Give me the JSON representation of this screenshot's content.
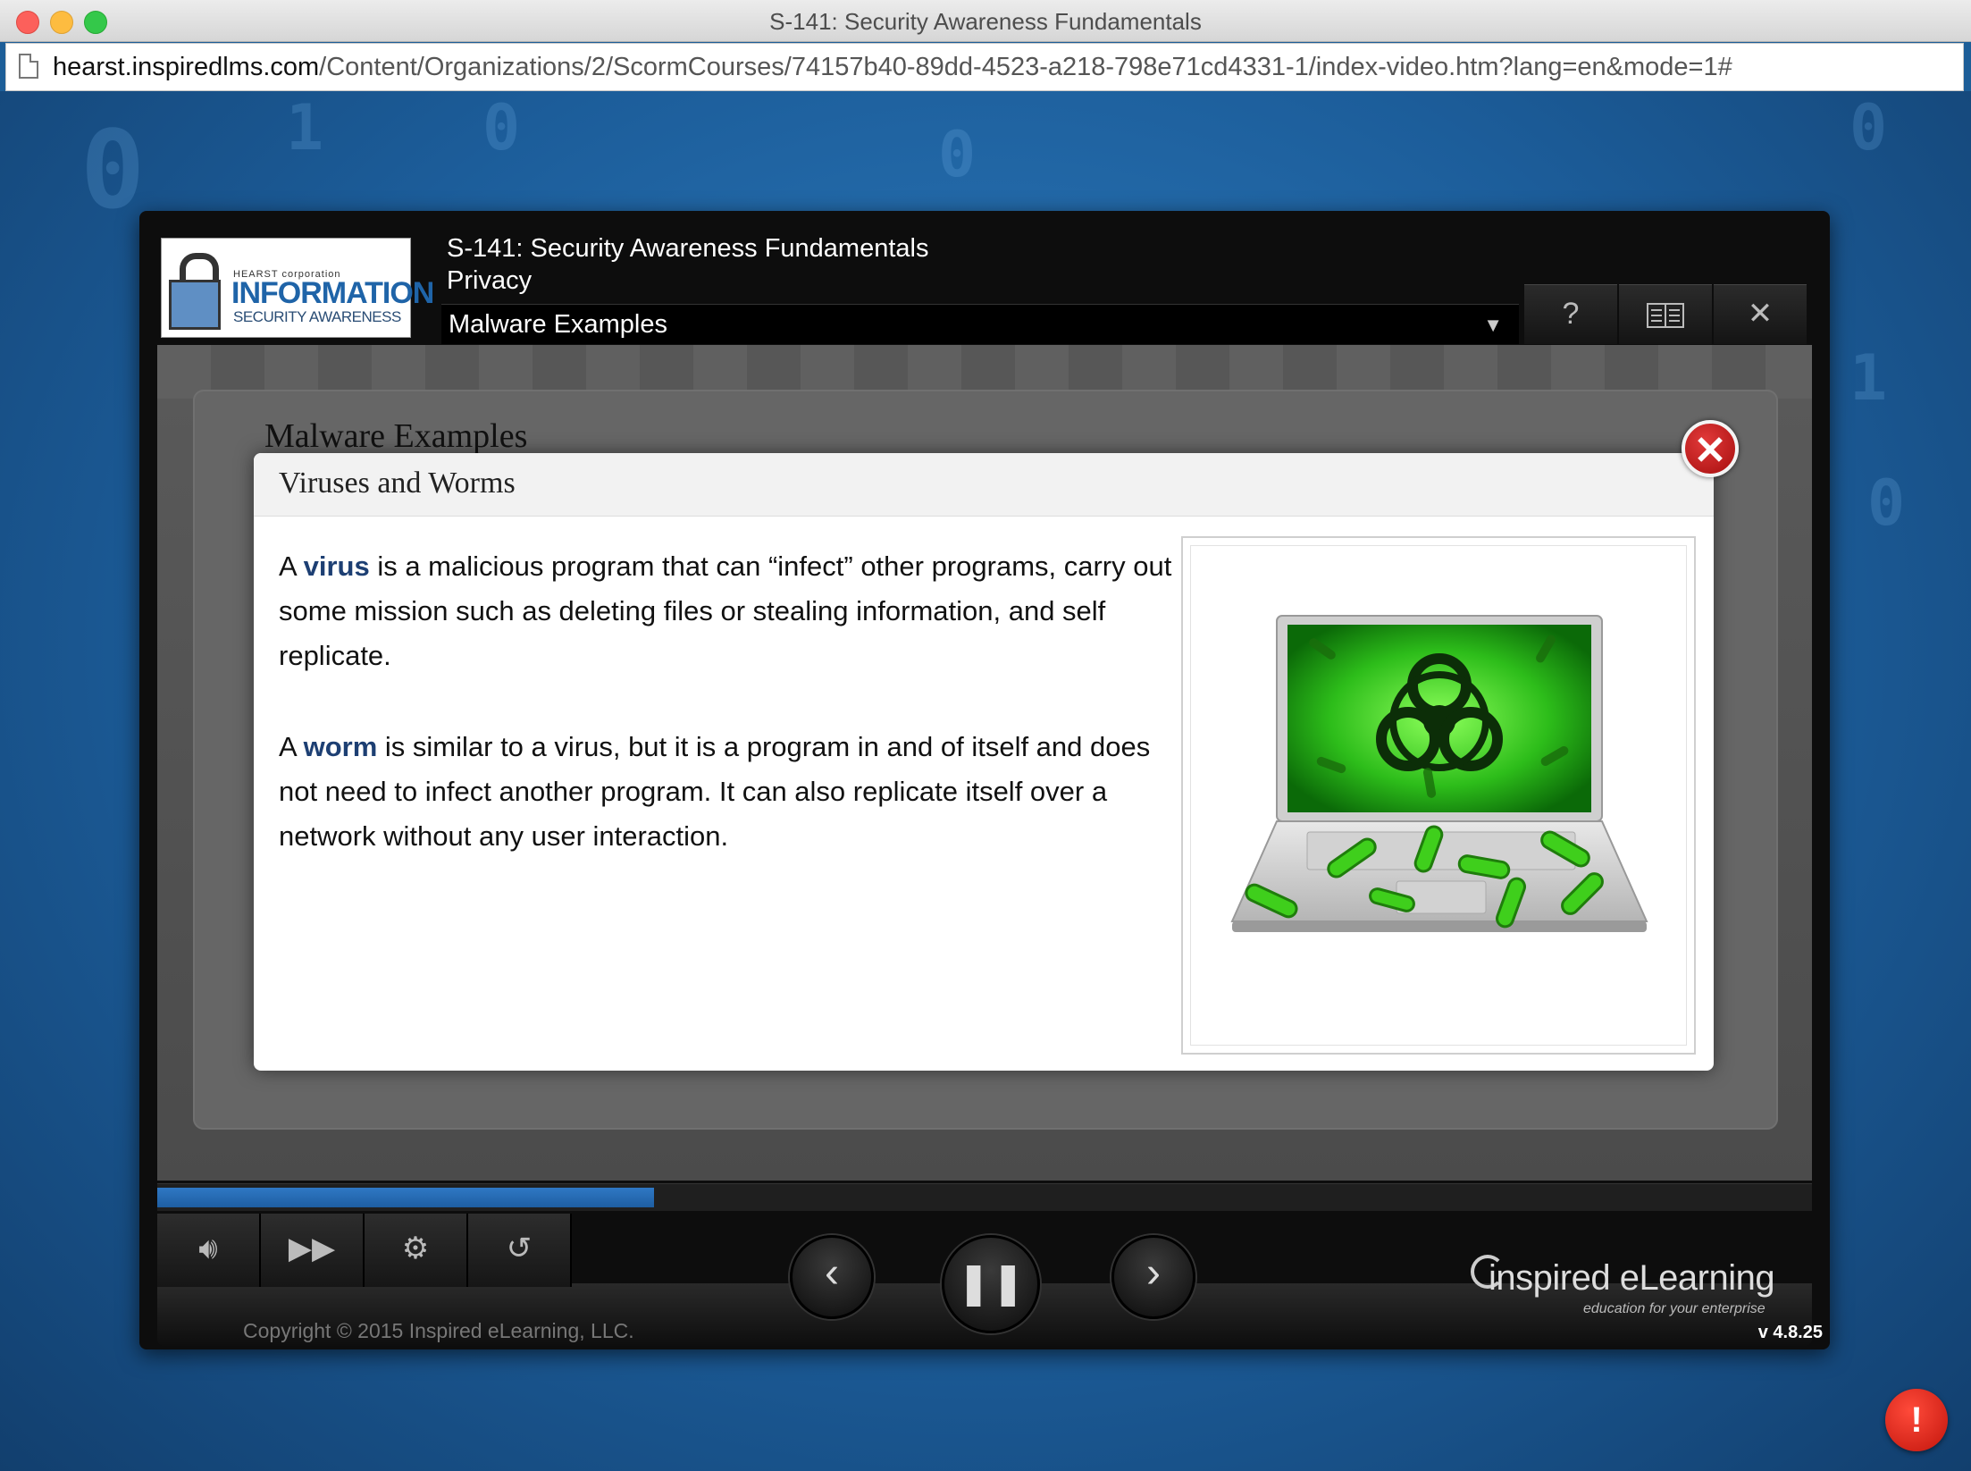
{
  "window": {
    "title": "S-141: Security Awareness Fundamentals"
  },
  "browser": {
    "url_host": "hearst.inspiredlms.com",
    "url_path": "/Content/Organizations/2/ScormCourses/74157b40-89dd-4523-a218-798e71cd4331-1/index-video.htm?lang=en&mode=1#"
  },
  "player": {
    "logo": {
      "small_text": "HEARST corporation",
      "title": "INFORMATION",
      "subtitle": "SECURITY AWARENESS"
    },
    "course_title": "S-141: Security Awareness Fundamentals",
    "module_title": "Privacy",
    "topic_selected": "Malware Examples",
    "toolbar": {
      "help_icon": "question-icon",
      "glossary_icon": "book-icon",
      "close_icon": "close-icon"
    },
    "slide_title": "Malware Examples",
    "progress": 0.3,
    "controls": {
      "volume_icon": "speaker-icon",
      "skip_icon": "fast-forward-icon",
      "settings_icon": "gear-icon",
      "replay_icon": "replay-icon",
      "prev_icon": "chevron-left-icon",
      "pause_icon": "pause-icon",
      "next_icon": "chevron-right-icon"
    },
    "copyright": "Copyright © 2015 Inspired eLearning, LLC.",
    "brand_name": "inspired eLearning",
    "brand_tagline": "education for your enterprise",
    "version": "v 4.8.25"
  },
  "popup": {
    "title": "Viruses and Worms",
    "paragraph1": {
      "prefix": "A",
      "term": "virus",
      "text": "is a malicious program that can “infect” other programs, carry out some mission such as deleting files or stealing information, and self replicate."
    },
    "paragraph2": {
      "prefix": "A",
      "term": "worm",
      "text": "is similar to a virus, but it is a program in and of itself and does not need to infect another program. It can also replicate itself over a network without any user interaction."
    },
    "image": "laptop-biohazard-virus-image"
  },
  "colors": {
    "accent": "#1e5ea2",
    "term": "#1d3f73",
    "alert": "#d0160c"
  }
}
